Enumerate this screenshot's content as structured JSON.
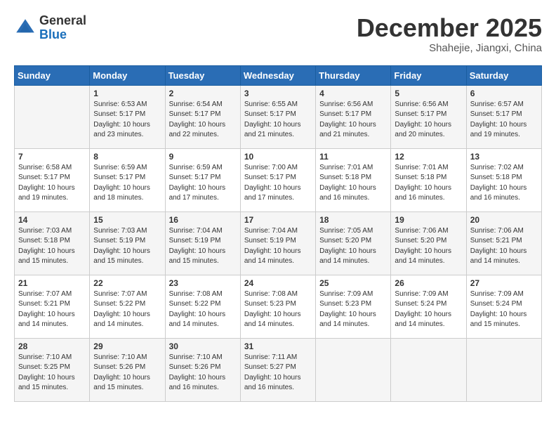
{
  "header": {
    "logo_line1": "General",
    "logo_line2": "Blue",
    "month": "December 2025",
    "location": "Shahejie, Jiangxi, China"
  },
  "weekdays": [
    "Sunday",
    "Monday",
    "Tuesday",
    "Wednesday",
    "Thursday",
    "Friday",
    "Saturday"
  ],
  "weeks": [
    [
      {
        "day": "",
        "info": ""
      },
      {
        "day": "1",
        "info": "Sunrise: 6:53 AM\nSunset: 5:17 PM\nDaylight: 10 hours and 23 minutes."
      },
      {
        "day": "2",
        "info": "Sunrise: 6:54 AM\nSunset: 5:17 PM\nDaylight: 10 hours and 22 minutes."
      },
      {
        "day": "3",
        "info": "Sunrise: 6:55 AM\nSunset: 5:17 PM\nDaylight: 10 hours and 21 minutes."
      },
      {
        "day": "4",
        "info": "Sunrise: 6:56 AM\nSunset: 5:17 PM\nDaylight: 10 hours and 21 minutes."
      },
      {
        "day": "5",
        "info": "Sunrise: 6:56 AM\nSunset: 5:17 PM\nDaylight: 10 hours and 20 minutes."
      },
      {
        "day": "6",
        "info": "Sunrise: 6:57 AM\nSunset: 5:17 PM\nDaylight: 10 hours and 19 minutes."
      }
    ],
    [
      {
        "day": "7",
        "info": "Sunrise: 6:58 AM\nSunset: 5:17 PM\nDaylight: 10 hours and 19 minutes."
      },
      {
        "day": "8",
        "info": "Sunrise: 6:59 AM\nSunset: 5:17 PM\nDaylight: 10 hours and 18 minutes."
      },
      {
        "day": "9",
        "info": "Sunrise: 6:59 AM\nSunset: 5:17 PM\nDaylight: 10 hours and 17 minutes."
      },
      {
        "day": "10",
        "info": "Sunrise: 7:00 AM\nSunset: 5:17 PM\nDaylight: 10 hours and 17 minutes."
      },
      {
        "day": "11",
        "info": "Sunrise: 7:01 AM\nSunset: 5:18 PM\nDaylight: 10 hours and 16 minutes."
      },
      {
        "day": "12",
        "info": "Sunrise: 7:01 AM\nSunset: 5:18 PM\nDaylight: 10 hours and 16 minutes."
      },
      {
        "day": "13",
        "info": "Sunrise: 7:02 AM\nSunset: 5:18 PM\nDaylight: 10 hours and 16 minutes."
      }
    ],
    [
      {
        "day": "14",
        "info": "Sunrise: 7:03 AM\nSunset: 5:18 PM\nDaylight: 10 hours and 15 minutes."
      },
      {
        "day": "15",
        "info": "Sunrise: 7:03 AM\nSunset: 5:19 PM\nDaylight: 10 hours and 15 minutes."
      },
      {
        "day": "16",
        "info": "Sunrise: 7:04 AM\nSunset: 5:19 PM\nDaylight: 10 hours and 15 minutes."
      },
      {
        "day": "17",
        "info": "Sunrise: 7:04 AM\nSunset: 5:19 PM\nDaylight: 10 hours and 14 minutes."
      },
      {
        "day": "18",
        "info": "Sunrise: 7:05 AM\nSunset: 5:20 PM\nDaylight: 10 hours and 14 minutes."
      },
      {
        "day": "19",
        "info": "Sunrise: 7:06 AM\nSunset: 5:20 PM\nDaylight: 10 hours and 14 minutes."
      },
      {
        "day": "20",
        "info": "Sunrise: 7:06 AM\nSunset: 5:21 PM\nDaylight: 10 hours and 14 minutes."
      }
    ],
    [
      {
        "day": "21",
        "info": "Sunrise: 7:07 AM\nSunset: 5:21 PM\nDaylight: 10 hours and 14 minutes."
      },
      {
        "day": "22",
        "info": "Sunrise: 7:07 AM\nSunset: 5:22 PM\nDaylight: 10 hours and 14 minutes."
      },
      {
        "day": "23",
        "info": "Sunrise: 7:08 AM\nSunset: 5:22 PM\nDaylight: 10 hours and 14 minutes."
      },
      {
        "day": "24",
        "info": "Sunrise: 7:08 AM\nSunset: 5:23 PM\nDaylight: 10 hours and 14 minutes."
      },
      {
        "day": "25",
        "info": "Sunrise: 7:09 AM\nSunset: 5:23 PM\nDaylight: 10 hours and 14 minutes."
      },
      {
        "day": "26",
        "info": "Sunrise: 7:09 AM\nSunset: 5:24 PM\nDaylight: 10 hours and 14 minutes."
      },
      {
        "day": "27",
        "info": "Sunrise: 7:09 AM\nSunset: 5:24 PM\nDaylight: 10 hours and 15 minutes."
      }
    ],
    [
      {
        "day": "28",
        "info": "Sunrise: 7:10 AM\nSunset: 5:25 PM\nDaylight: 10 hours and 15 minutes."
      },
      {
        "day": "29",
        "info": "Sunrise: 7:10 AM\nSunset: 5:26 PM\nDaylight: 10 hours and 15 minutes."
      },
      {
        "day": "30",
        "info": "Sunrise: 7:10 AM\nSunset: 5:26 PM\nDaylight: 10 hours and 16 minutes."
      },
      {
        "day": "31",
        "info": "Sunrise: 7:11 AM\nSunset: 5:27 PM\nDaylight: 10 hours and 16 minutes."
      },
      {
        "day": "",
        "info": ""
      },
      {
        "day": "",
        "info": ""
      },
      {
        "day": "",
        "info": ""
      }
    ]
  ]
}
